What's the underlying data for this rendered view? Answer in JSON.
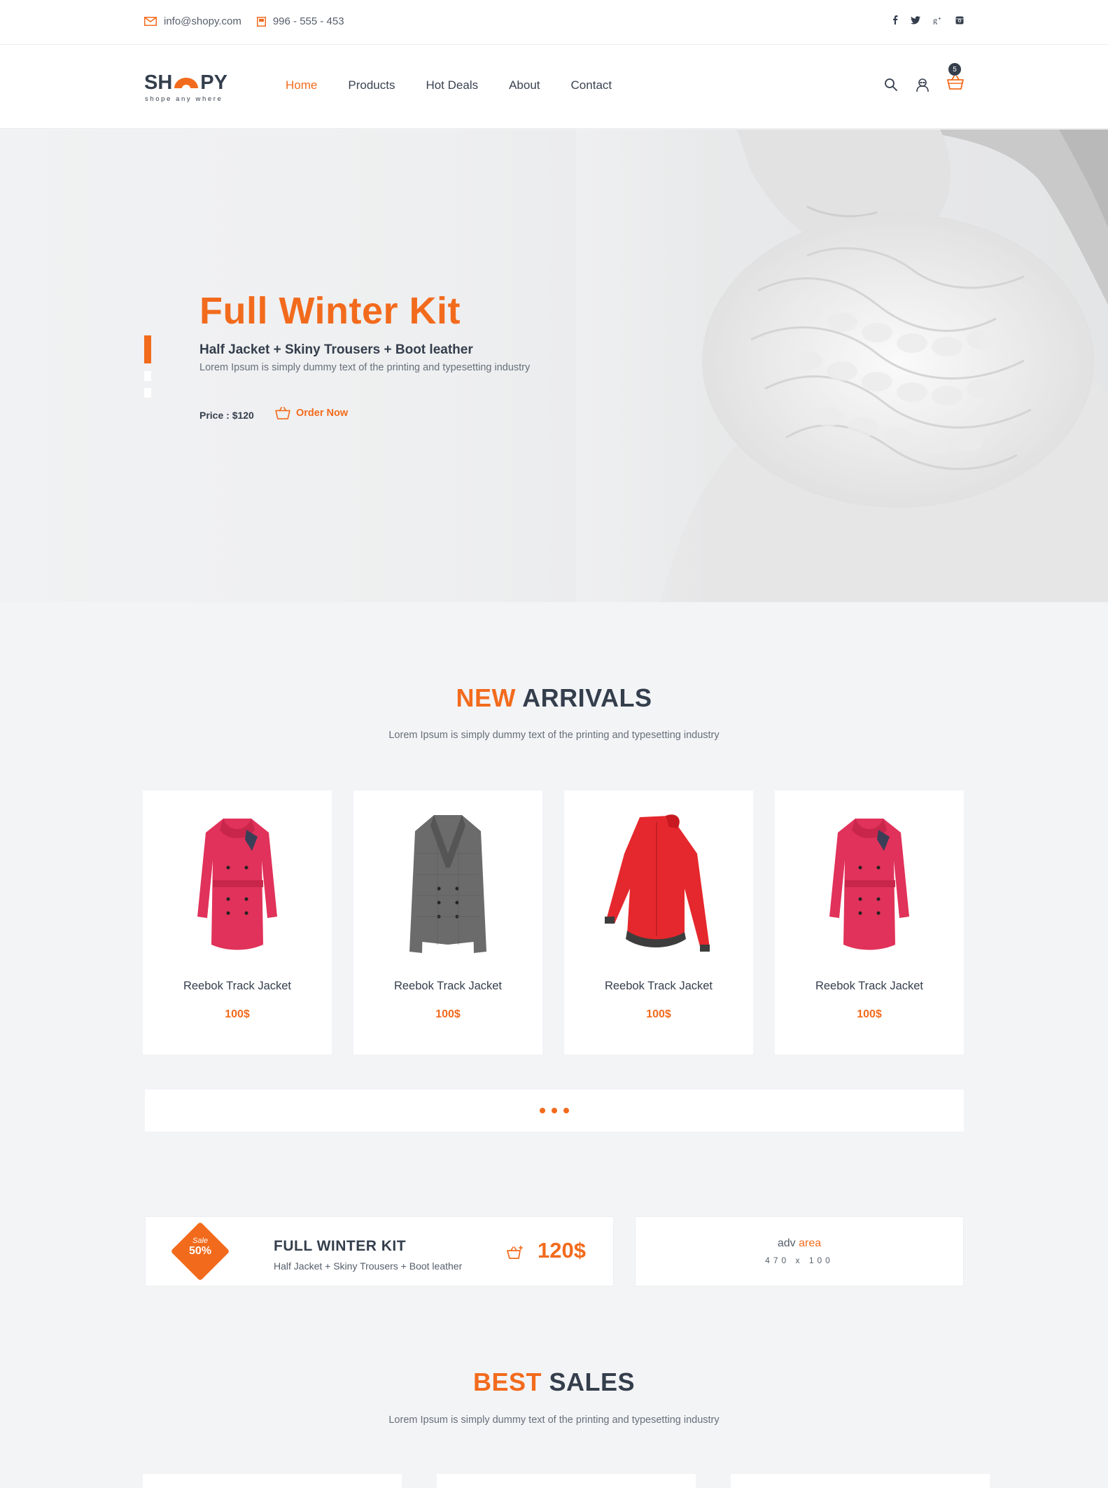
{
  "topbar": {
    "email": "info@shopy.com",
    "phone": "996 - 555 - 453",
    "social": [
      "facebook-icon",
      "twitter-icon",
      "google-plus-icon",
      "instagram-icon"
    ]
  },
  "header": {
    "logo_left": "SH",
    "logo_right": "PY",
    "logo_tagline": "shope any where",
    "nav": [
      "Home",
      "Products",
      "Hot Deals",
      "About",
      "Contact"
    ],
    "cart_count": "5"
  },
  "hero": {
    "title": "Full Winter Kit",
    "subtitle": "Half Jacket + Skiny Trousers + Boot leather",
    "description": "Lorem Ipsum is simply dummy text of the printing and typesetting industry",
    "price": "Price : $120",
    "order_label": "Order Now"
  },
  "new_arrivals": {
    "title_accent": "NEW",
    "title_rest": "ARRIVALS",
    "description": "Lorem Ipsum is simply dummy text of the printing and typesetting industry",
    "products": [
      {
        "name": "Reebok Track Jacket",
        "price": "100$"
      },
      {
        "name": "Reebok Track Jacket",
        "price": "100$"
      },
      {
        "name": "Reebok Track Jacket",
        "price": "100$"
      },
      {
        "name": "Reebok Track Jacket",
        "price": "100$"
      }
    ]
  },
  "promo": {
    "badge_top": "Sale",
    "badge_percent": "50%",
    "title": "FULL WINTER KIT",
    "description": "Half Jacket + Skiny Trousers + Boot leather",
    "price": "120$"
  },
  "adv": {
    "label": "adv",
    "label_accent": "area",
    "size": "470 x 100"
  },
  "best_sales": {
    "title_accent": "BEST",
    "title_rest": "SALES",
    "description": "Lorem Ipsum is simply dummy text of the printing and typesetting industry"
  },
  "colors": {
    "accent": "#f26b1d",
    "dark": "#343e4c",
    "background": "#f3f4f6"
  }
}
